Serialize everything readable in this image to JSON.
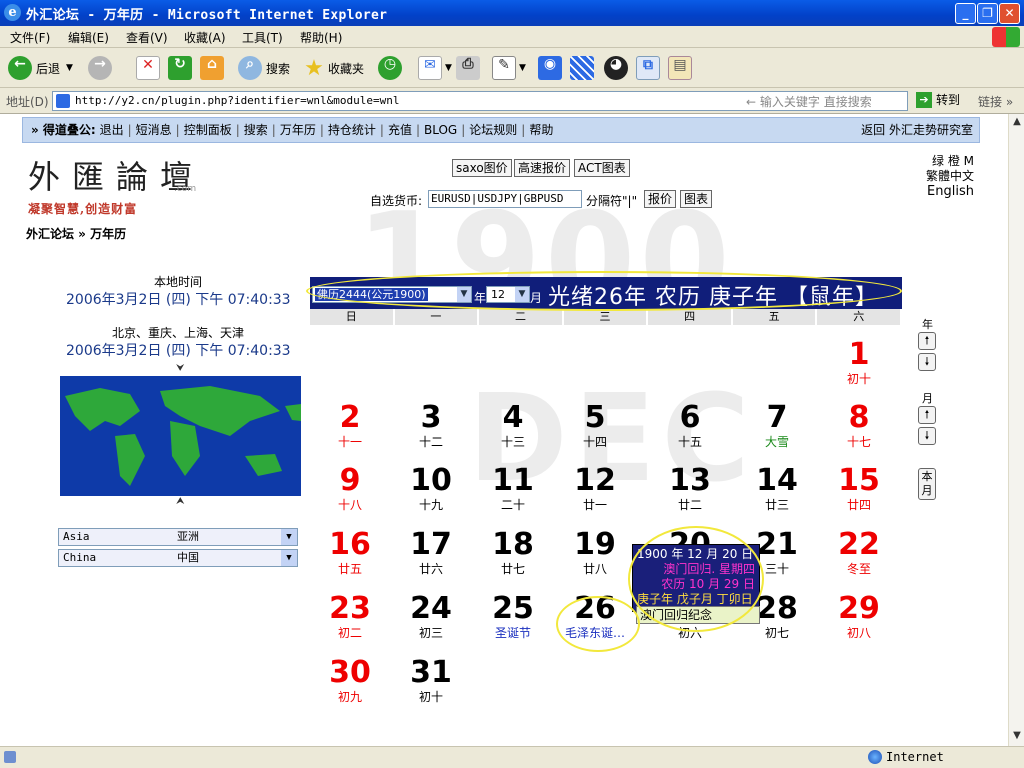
{
  "window": {
    "title": "外汇论坛 - 万年历 - Microsoft Internet Explorer"
  },
  "menu": [
    "文件(F)",
    "编辑(E)",
    "查看(V)",
    "收藏(A)",
    "工具(T)",
    "帮助(H)"
  ],
  "toolbar": {
    "back": "后退",
    "search": "搜索",
    "favorites": "收藏夹"
  },
  "address": {
    "label": "地址(D)",
    "url": "http://y2.cn/plugin.php?identifier=wnl&module=wnl",
    "keyword_hint": "输入关键字  直接搜索",
    "go": "转到",
    "links": "链接"
  },
  "nav": {
    "prefix": "» 得道叠公:",
    "items": [
      "退出",
      "短消息",
      "控制面板",
      "搜索",
      "万年历",
      "持仓统计",
      "充值",
      "BLOG",
      "论坛规则",
      "帮助"
    ],
    "right": "返回 外汇走势研究室"
  },
  "logo": {
    "chars": "外匯論壇",
    "slogan": "凝聚智慧,创造财富",
    "com": ".com"
  },
  "tools": {
    "saxo": "saxo图价",
    "quote": "高速报价",
    "act": "ACT图表",
    "currency_label": "自选货币:",
    "currency_value": "EURUSD|USDJPY|GBPUSD",
    "sep_label": "分隔符\"|\"",
    "price_btn": "报价",
    "chart_btn": "图表"
  },
  "lang": {
    "green": "绿 橙 M",
    "trad": "繁體中文",
    "en": "English"
  },
  "breadcrumb": "外汇论坛 » 万年历",
  "background": {
    "year": "1900",
    "month": "DEC"
  },
  "clock": {
    "local_label": "本地时间",
    "local_value": "2006年3月2日 (四) 下午 07:40:33",
    "city_label": "北京、重庆、上海、天津",
    "city_value": "2006年3月2日 (四) 下午 07:40:33"
  },
  "region": {
    "continent_en": "Asia",
    "continent_zh": "亚洲",
    "country_en": "China",
    "country_zh": "中国"
  },
  "calendar": {
    "year_select": "佛历2444(公元1900)",
    "year_suffix": "年",
    "month_select": "12",
    "month_suffix": "月",
    "lunar_title": "光绪26年 农历 庚子年 【鼠年】",
    "weekdays": [
      "日",
      "一",
      "二",
      "三",
      "四",
      "五",
      "六"
    ],
    "days": [
      {
        "d": "1",
        "l": "初十"
      },
      {
        "d": "2",
        "l": "十一"
      },
      {
        "d": "3",
        "l": "十二"
      },
      {
        "d": "4",
        "l": "十三"
      },
      {
        "d": "5",
        "l": "十四"
      },
      {
        "d": "6",
        "l": "十五"
      },
      {
        "d": "7",
        "l": "大雪"
      },
      {
        "d": "8",
        "l": "十七"
      },
      {
        "d": "9",
        "l": "十八"
      },
      {
        "d": "10",
        "l": "十九"
      },
      {
        "d": "11",
        "l": "二十"
      },
      {
        "d": "12",
        "l": "廿一"
      },
      {
        "d": "13",
        "l": "廿二"
      },
      {
        "d": "14",
        "l": "廿三"
      },
      {
        "d": "15",
        "l": "廿四"
      },
      {
        "d": "16",
        "l": "廿五"
      },
      {
        "d": "17",
        "l": "廿六"
      },
      {
        "d": "18",
        "l": "廿七"
      },
      {
        "d": "19",
        "l": "廿八"
      },
      {
        "d": "20",
        "l": ""
      },
      {
        "d": "21",
        "l": "三十"
      },
      {
        "d": "22",
        "l": "冬至"
      },
      {
        "d": "23",
        "l": "初二"
      },
      {
        "d": "24",
        "l": "初三"
      },
      {
        "d": "25",
        "l": "圣诞节"
      },
      {
        "d": "26",
        "l": "毛泽东诞…"
      },
      {
        "d": "27",
        "l": "初六"
      },
      {
        "d": "28",
        "l": "初七"
      },
      {
        "d": "29",
        "l": "初八"
      },
      {
        "d": "30",
        "l": "初九"
      },
      {
        "d": "31",
        "l": "初十"
      }
    ],
    "side": {
      "year": "年",
      "month": "月",
      "this_month": "本月"
    }
  },
  "tooltip": {
    "line1": "1900 年 12 月 20 日",
    "line2": "澳门回归.  星期四",
    "line3": "农历 10 月 29 日",
    "line4": "庚子年 戊子月 丁卯日",
    "memo": "澳门回归纪念"
  },
  "status": {
    "zone": "Internet"
  }
}
